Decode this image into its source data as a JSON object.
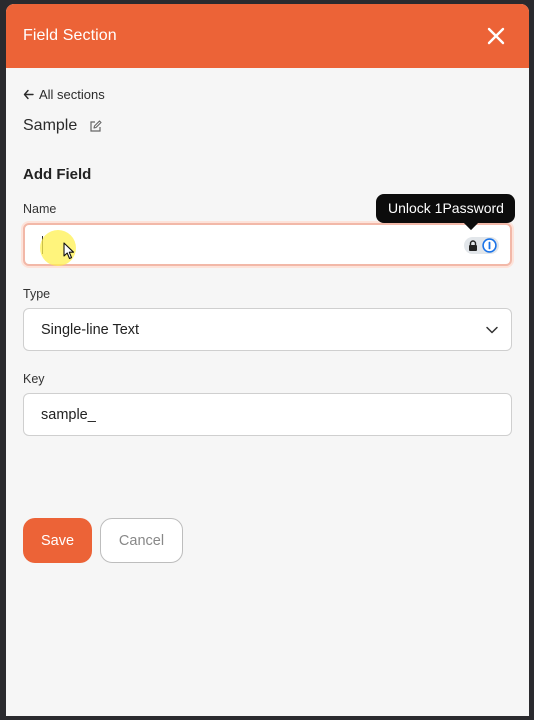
{
  "header": {
    "title": "Field Section",
    "close_icon": "close-icon"
  },
  "nav": {
    "back_label": "All sections"
  },
  "section": {
    "name": "Sample"
  },
  "form": {
    "title": "Add Field",
    "name_label": "Name",
    "name_value": "",
    "type_label": "Type",
    "type_value": "Single-line Text",
    "key_label": "Key",
    "key_value": "sample_"
  },
  "tooltip": {
    "text": "Unlock 1Password"
  },
  "actions": {
    "save_label": "Save",
    "cancel_label": "Cancel"
  },
  "colors": {
    "accent": "#ec6337",
    "background": "#f6f6f6",
    "tooltip_bg": "#0c0c0c"
  }
}
